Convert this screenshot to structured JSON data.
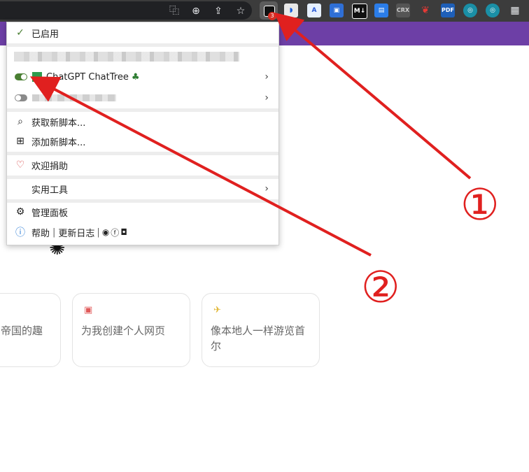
{
  "toolbar": {
    "address_icons": [
      "translate-icon",
      "zoom-icon",
      "share-icon",
      "star-icon"
    ],
    "extensions": [
      "tampermonkey-icon",
      "bitwarden-icon",
      "a-icon",
      "save-icon",
      "markdown-icon",
      "file-icon",
      "crx-icon",
      "sprout-icon",
      "pdf-icon",
      "ext1-icon",
      "ext2-icon",
      "puzzle-icon"
    ],
    "badge_count": "3",
    "crx_label": "CRX",
    "pdf_label": "PDF",
    "markdown_label": "M↓"
  },
  "menu": {
    "enabled_label": "已启用",
    "script1_name": "ChatGPT ChatTree",
    "script2_name": "",
    "get_scripts": "获取新脚本...",
    "add_script": "添加新脚本...",
    "donate": "欢迎捐助",
    "utilities": "实用工具",
    "dashboard": "管理面板",
    "help": "帮助",
    "sep": "|",
    "changelog": "更新日志",
    "sep2": "|"
  },
  "page": {
    "card1_text": "帝国的趣",
    "card2_text": "为我创建个人网页",
    "card3_text": "像本地人一样游览首尔"
  },
  "annotations": {
    "label1": "①",
    "label2": "②"
  },
  "colors": {
    "purple_bar": "#6d3fa6",
    "annotation_red": "#e0201f",
    "toggle_on": "#4a7f33"
  }
}
